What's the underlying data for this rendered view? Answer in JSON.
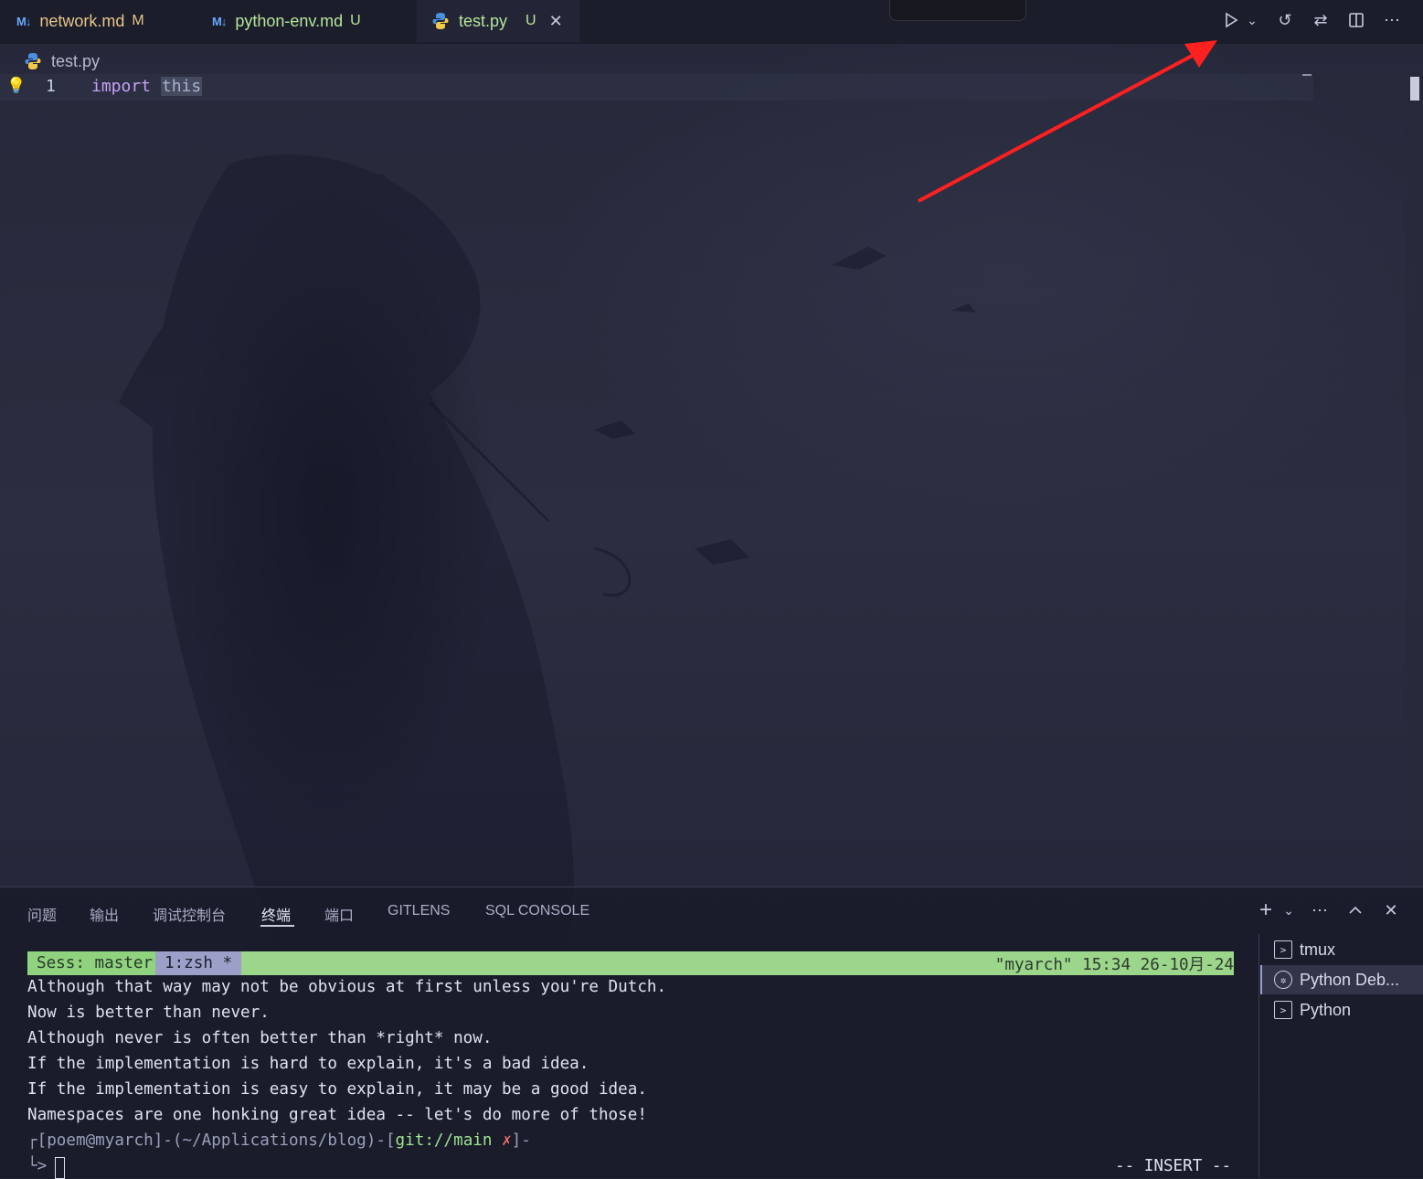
{
  "tabs": [
    {
      "name": "network.md",
      "badge": "M",
      "type": "md"
    },
    {
      "name": "python-env.md",
      "badge": "U",
      "type": "md"
    },
    {
      "name": "test.py",
      "badge": "U",
      "type": "py",
      "active": true
    }
  ],
  "icons": {
    "md": "M↓",
    "run": "▷",
    "run_dropdown": "⌄",
    "history": "↺",
    "compare": "⇄",
    "split": "▯",
    "more": "⋯",
    "close": "✕",
    "lightbulb": "💡",
    "add": "+",
    "chevron_down": "⌄",
    "maximize": "︿"
  },
  "breadcrumb": {
    "file": "test.py"
  },
  "editor": {
    "line_number": "1",
    "keyword": "import",
    "module": "this"
  },
  "panel": {
    "tabs": [
      "问题",
      "输出",
      "调试控制台",
      "终端",
      "端口",
      "GITLENS",
      "SQL CONSOLE"
    ],
    "active_tab": "终端"
  },
  "terminal": {
    "session": "Sess: master",
    "window": "1:zsh *",
    "status_right": "\"myarch\" 15:34 26-10月-24",
    "lines": [
      "Although that way may not be obvious at first unless you're Dutch.",
      "Now is better than never.",
      "Although never is often better than *right* now.",
      "If the implementation is hard to explain, it's a bad idea.",
      "If the implementation is easy to explain, it may be a good idea.",
      "Namespaces are one honking great idea -- let's do more of those!"
    ],
    "prompt_user": "poem",
    "prompt_host": "myarch",
    "prompt_path": "~/Applications/blog",
    "prompt_git": "git://main",
    "prompt_dirty": "✗",
    "prompt2": "└>",
    "mode": "-- INSERT --"
  },
  "terminal_list": [
    {
      "name": "tmux",
      "icon": "terminal-icon"
    },
    {
      "name": "Python Deb...",
      "icon": "debug-icon",
      "active": true
    },
    {
      "name": "Python",
      "icon": "terminal-icon"
    }
  ],
  "colors": {
    "annotation_arrow": "#ff2020",
    "status_green": "#9bd68b",
    "window_lavender": "#9c9fc8"
  }
}
